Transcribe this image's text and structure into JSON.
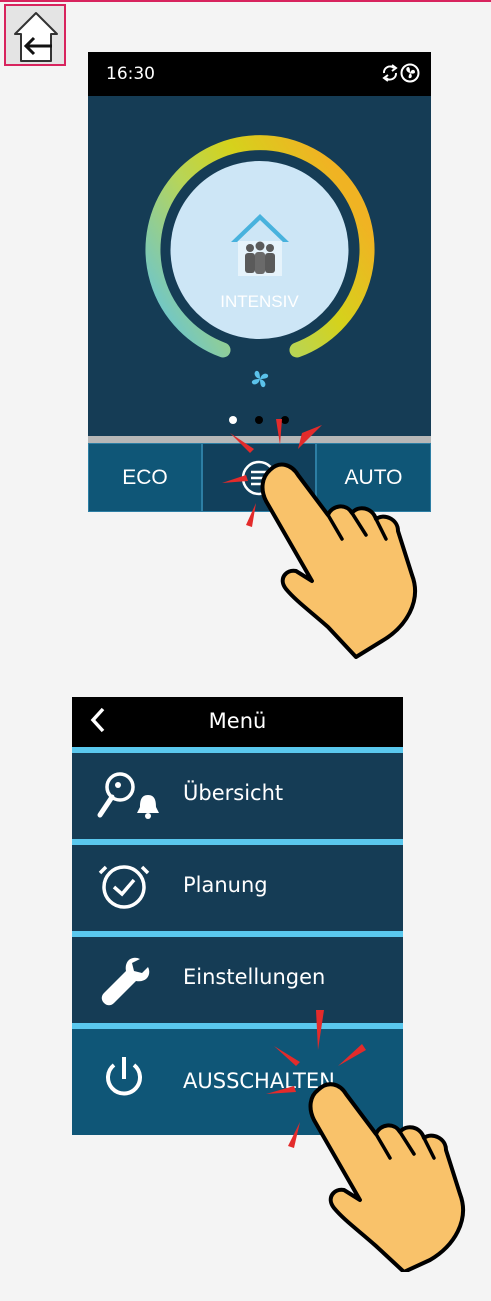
{
  "top_icon": "home-back-icon",
  "screen1": {
    "time": "16:30",
    "status_icons": [
      "sync-icon",
      "fan-status-icon"
    ],
    "mode_label": "INTENSIV",
    "mode_icon": "house-family-icon",
    "fan_icon": "fan-icon",
    "page_dots": 3,
    "active_dot": 1,
    "buttons": {
      "eco": "ECO",
      "menu_icon": "menu-icon",
      "auto": "AUTO"
    },
    "colors": {
      "bg": "#153c55",
      "button": "#0f5677",
      "arc_start": "#5bc2ea",
      "arc_mid": "#c8d223",
      "arc_end": "#f0b323"
    }
  },
  "screen2": {
    "back_icon": "chevron-left-icon",
    "title": "Menü",
    "items": [
      {
        "label": "Übersicht",
        "icon": "search-bell-icon"
      },
      {
        "label": "Planung",
        "icon": "clock-check-icon"
      },
      {
        "label": "Einstellungen",
        "icon": "wrench-icon"
      },
      {
        "label": "AUSSCHALTEN",
        "icon": "power-icon"
      }
    ],
    "colors": {
      "separator": "#5ac8ee",
      "highlight": "#0f5677"
    }
  },
  "gesture_icons": [
    "tap-hand-icon",
    "tap-hand-icon"
  ]
}
